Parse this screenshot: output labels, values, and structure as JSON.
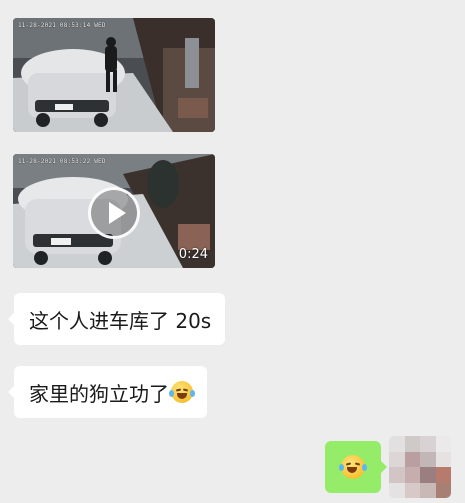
{
  "chat": {
    "messages": [
      {
        "type": "image",
        "direction": "incoming",
        "camera_stamp": "11-28-2021 08:53:14 WED"
      },
      {
        "type": "video",
        "direction": "incoming",
        "camera_stamp": "11-28-2021 08:53:22 WED",
        "duration": "0:24"
      },
      {
        "type": "text",
        "direction": "incoming",
        "text": "这个人进车库了 20s"
      },
      {
        "type": "text",
        "direction": "incoming",
        "text": "家里的狗立功了",
        "emoji": "crying-laughing-emoji"
      },
      {
        "type": "sticker",
        "direction": "outgoing",
        "emoji": "crying-laughing-emoji"
      }
    ]
  },
  "colors": {
    "background": "#ededed",
    "incoming_bubble": "#ffffff",
    "outgoing_bubble": "#95ec69"
  },
  "icons": {
    "play": "play-icon",
    "avatar": "blurred-avatar"
  }
}
